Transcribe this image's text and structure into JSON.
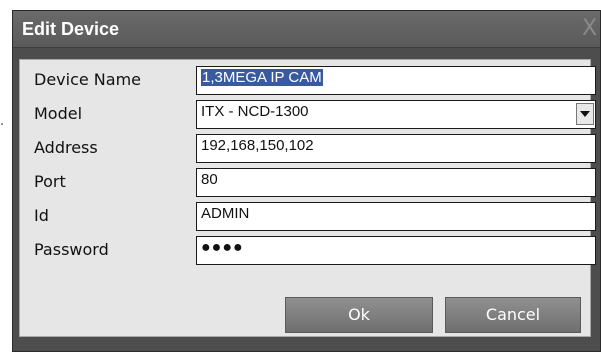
{
  "window": {
    "title": "Edit Device",
    "close_glyph": "X"
  },
  "side_mark": "·",
  "form": {
    "device_name": {
      "label": "Device Name",
      "value": "1,3MEGA IP CAM"
    },
    "model": {
      "label": "Model",
      "value": "ITX - NCD-1300"
    },
    "address": {
      "label": "Address",
      "value": "192,168,150,102"
    },
    "port": {
      "label": "Port",
      "value": "80"
    },
    "id": {
      "label": "Id",
      "value": "ADMIN"
    },
    "password": {
      "label": "Password",
      "value": "●●●●"
    }
  },
  "buttons": {
    "ok": "Ok",
    "cancel": "Cancel"
  },
  "icons": {
    "select_arrow": "chevron-down-icon",
    "close": "close-icon"
  }
}
